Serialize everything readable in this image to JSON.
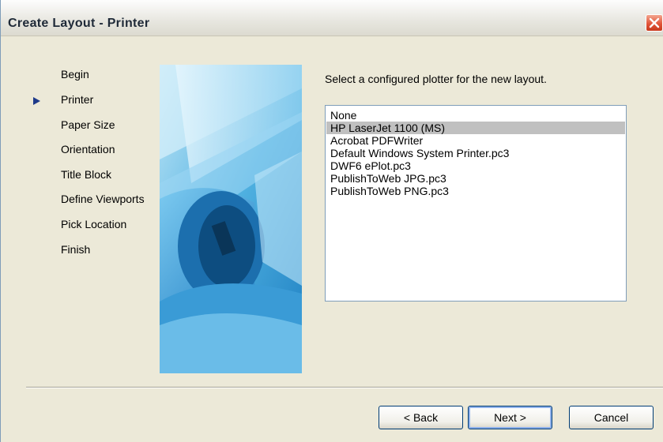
{
  "window": {
    "title": "Create Layout - Printer"
  },
  "wizard": {
    "current_step": "Printer",
    "steps": [
      {
        "label": "Begin"
      },
      {
        "label": "Printer"
      },
      {
        "label": "Paper Size"
      },
      {
        "label": "Orientation"
      },
      {
        "label": "Title Block"
      },
      {
        "label": "Define Viewports"
      },
      {
        "label": "Pick Location"
      },
      {
        "label": "Finish"
      }
    ]
  },
  "main": {
    "instruction": "Select a configured plotter for the new layout.",
    "plotters": [
      {
        "label": "None"
      },
      {
        "label": "HP LaserJet 1100 (MS)"
      },
      {
        "label": "Acrobat PDFWriter"
      },
      {
        "label": "Default Windows System Printer.pc3"
      },
      {
        "label": "DWF6 ePlot.pc3"
      },
      {
        "label": "PublishToWeb JPG.pc3"
      },
      {
        "label": "PublishToWeb PNG.pc3"
      }
    ],
    "selected_plotter": "HP LaserJet 1100 (MS)"
  },
  "buttons": {
    "back": "< Back",
    "next": "Next >",
    "cancel": "Cancel"
  },
  "colors": {
    "selection": "#c0c0c0",
    "close_button": "#e1553a",
    "step_arrow": "#1e3a8a"
  },
  "icons": {
    "close": "close-icon",
    "step_pointer": "arrow-right-icon"
  }
}
